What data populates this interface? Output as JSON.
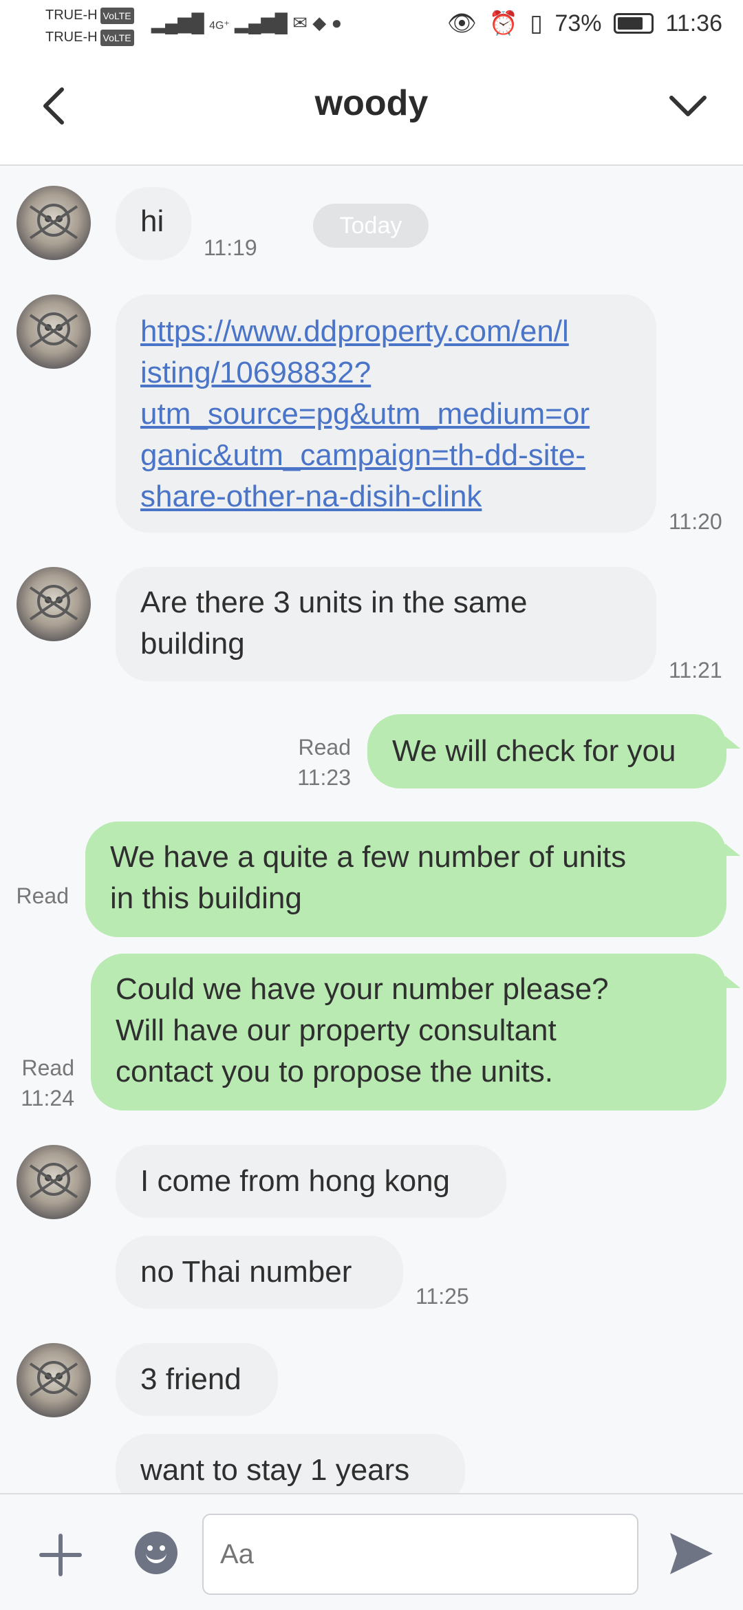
{
  "status_bar": {
    "carrier1": "TRUE-H",
    "carrier2": "TRUE-H",
    "volte": "VoLTE",
    "network": "4G⁺",
    "battery": "73%",
    "time": "11:36"
  },
  "header": {
    "title": "woody"
  },
  "divider": {
    "label": "Today"
  },
  "messages": [
    {
      "side": "in",
      "text": "hi",
      "time": "11:19"
    },
    {
      "side": "in",
      "text": "https://www.ddproperty.com/en/listing/10698832?utm_source=pg&utm_medium=organic&utm_campaign=th-dd-site-share-other-na-disih-clink",
      "lines": [
        "https://www.ddproperty.com/en/l",
        "isting/10698832?",
        "utm_source=pg&utm_medium=or",
        "ganic&utm_campaign=th-dd-site-",
        "share-other-na-disih-clink"
      ],
      "time": "11:20"
    },
    {
      "side": "in",
      "lines": [
        "Are there 3 units in the same",
        "building"
      ],
      "time": "11:21"
    },
    {
      "side": "out",
      "text": "We will check for you",
      "status": "Read",
      "time": "11:23"
    },
    {
      "side": "out",
      "lines": [
        "We have a quite a few number of units",
        "in this building"
      ],
      "status": "Read"
    },
    {
      "side": "out",
      "lines": [
        "Could we have your number please?",
        "Will have our property consultant",
        "contact you to propose the units."
      ],
      "status": "Read",
      "time": "11:24"
    },
    {
      "side": "in",
      "text": "I come from hong kong"
    },
    {
      "side": "in",
      "text": "no Thai number",
      "time": "11:25"
    },
    {
      "side": "in",
      "text": "3 friend"
    },
    {
      "side": "in",
      "text": "want to stay 1 years"
    }
  ],
  "composer": {
    "placeholder": "Aa"
  }
}
